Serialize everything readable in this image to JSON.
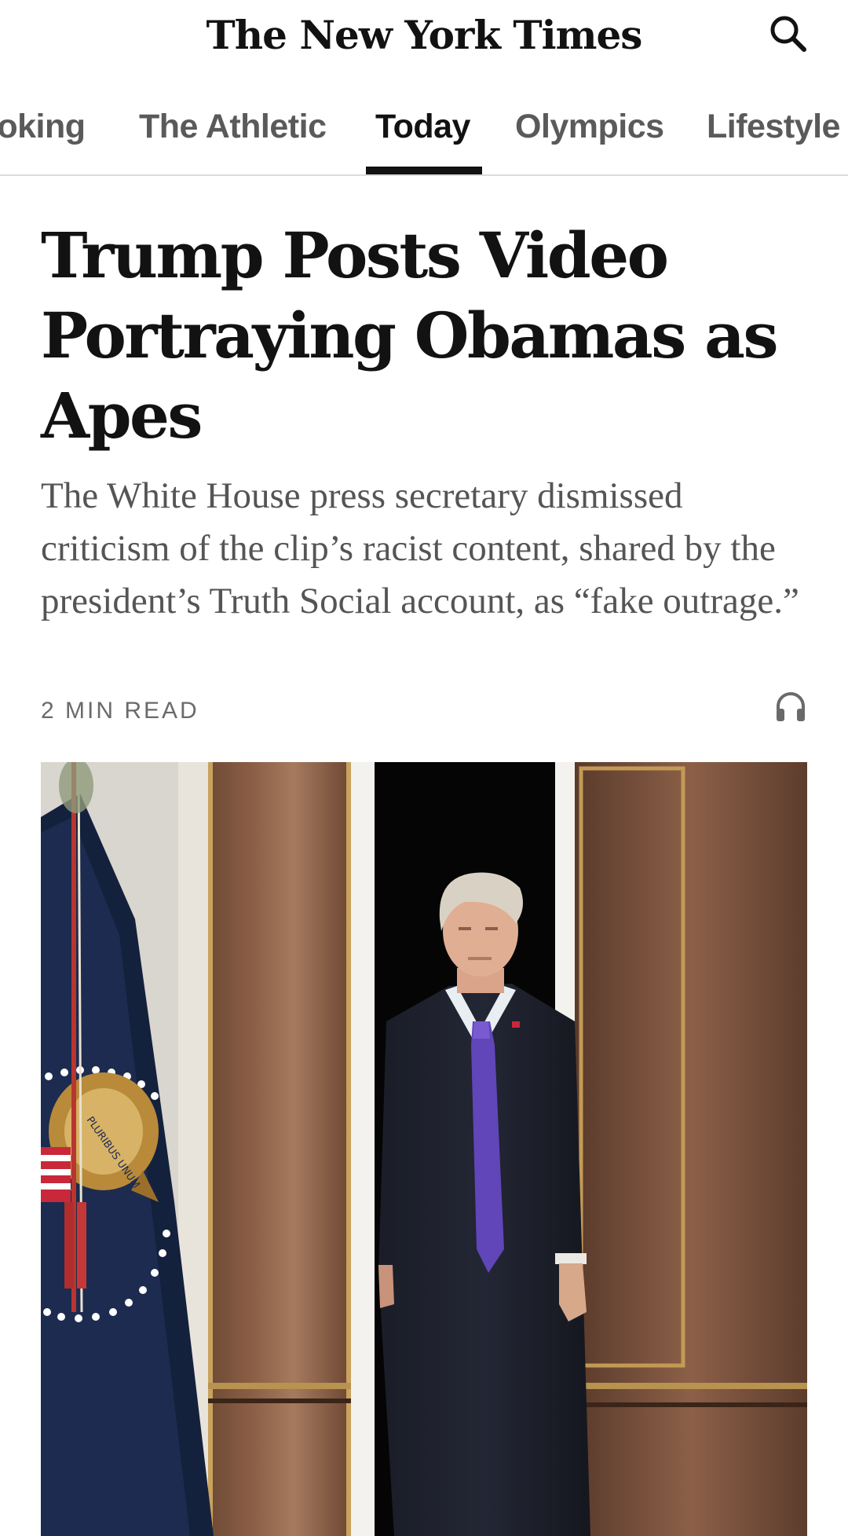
{
  "masthead": {
    "logo_text": "The New York Times",
    "search_icon": "search-icon"
  },
  "nav": {
    "items": [
      {
        "label": "Cooking",
        "active": false
      },
      {
        "label": "The Athletic",
        "active": false
      },
      {
        "label": "Today",
        "active": true
      },
      {
        "label": "Olympics",
        "active": false
      },
      {
        "label": "Lifestyle",
        "active": false
      }
    ]
  },
  "article": {
    "headline": "Trump Posts Video Portraying Obamas as Apes",
    "summary": "The White House press secretary dismissed criticism of the clip’s racist content, shared by the president’s Truth Social account, as “fake outrage.”",
    "read_time": "2 MIN READ",
    "listen_icon": "headphones-icon",
    "photo_seal_text": "PLURIBUS UNUM"
  },
  "colors": {
    "text_primary": "#121212",
    "text_secondary": "#555555",
    "nav_inactive": "#5a5a5a",
    "divider": "#dcdcdc"
  }
}
